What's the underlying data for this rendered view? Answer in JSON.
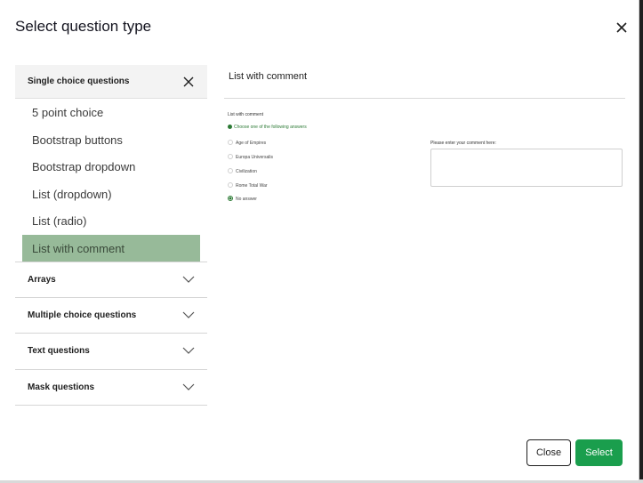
{
  "modal": {
    "title": "Select question type"
  },
  "sidebar": {
    "open_group": {
      "label": "Single choice questions",
      "items": [
        {
          "label": "5 point choice"
        },
        {
          "label": "Bootstrap buttons"
        },
        {
          "label": "Bootstrap dropdown"
        },
        {
          "label": "List (dropdown)"
        },
        {
          "label": "List (radio)"
        },
        {
          "label": "List with comment"
        }
      ],
      "active_index": 5
    },
    "closed_groups": [
      {
        "label": "Arrays"
      },
      {
        "label": "Multiple choice questions"
      },
      {
        "label": "Text questions"
      },
      {
        "label": "Mask questions"
      }
    ]
  },
  "preview": {
    "title": "List with comment",
    "question_text": "List with comment",
    "help_text": "Choose one of the following answers",
    "options": [
      {
        "label": "Age of Empires",
        "selected": false
      },
      {
        "label": "Europa Universalis",
        "selected": false
      },
      {
        "label": "Civilization",
        "selected": false
      },
      {
        "label": "Rome Total War",
        "selected": false
      },
      {
        "label": "No answer",
        "selected": true
      }
    ],
    "comment_label": "Please enter your comment here:"
  },
  "footer": {
    "close_label": "Close",
    "select_label": "Select"
  },
  "colors": {
    "active_item_bg": "#97ba99",
    "primary_button": "#1a9e4d",
    "help_text": "#2c7a35"
  },
  "icons": {
    "modal_close": "close-icon",
    "group_close": "close-icon",
    "group_expand": "chevron-down-icon"
  }
}
